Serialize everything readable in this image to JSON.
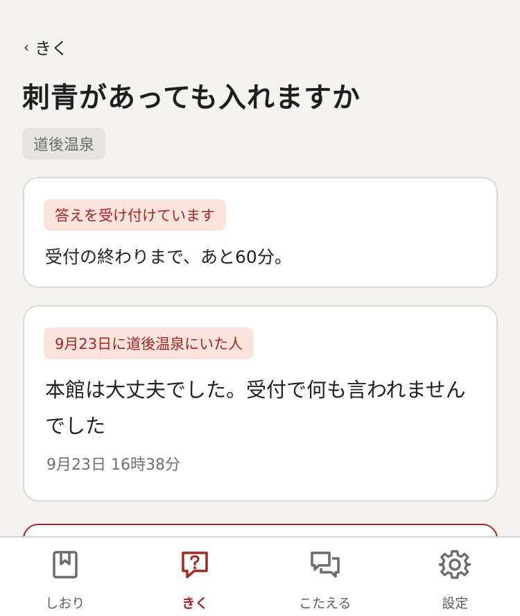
{
  "header": {
    "back_label": "きく",
    "title": "刺青があっても入れますか",
    "place": "道後温泉"
  },
  "cards": [
    {
      "tag": "答えを受け付けています",
      "body": "受付の終わりまで、あと60分。"
    },
    {
      "tag": "9月23日に道後温泉にいた人",
      "body": "本館は大丈夫でした。受付で何も言われませんでした",
      "time": "9月23日 16時38分"
    }
  ],
  "tabbar": {
    "items": [
      {
        "label": "しおり",
        "icon": "bookmark-icon",
        "active": false
      },
      {
        "label": "きく",
        "icon": "question-bubble-icon",
        "active": true
      },
      {
        "label": "こたえる",
        "icon": "chat-bubbles-icon",
        "active": false
      },
      {
        "label": "設定",
        "icon": "gear-icon",
        "active": false
      }
    ]
  },
  "colors": {
    "accent": "#a3261f",
    "tag_bg": "#fbe4de",
    "page_bg": "#f5f3ef",
    "icon_gray": "#6b6b6b"
  }
}
